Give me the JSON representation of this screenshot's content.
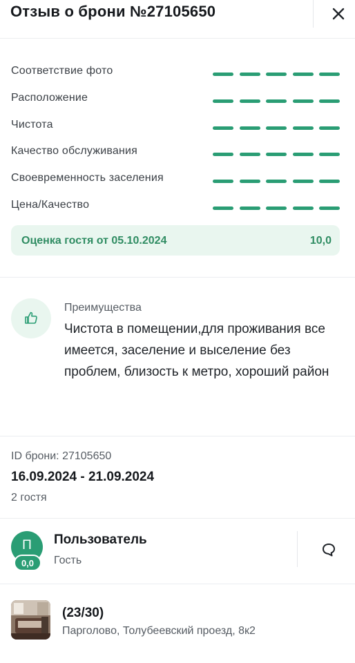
{
  "header": {
    "title": "Отзыв о брони №27105650",
    "close_icon": "close-icon"
  },
  "ratings": [
    {
      "label": "Соответствие фото",
      "filled": 5,
      "max": 5
    },
    {
      "label": "Расположение",
      "filled": 5,
      "max": 5
    },
    {
      "label": "Чистота",
      "filled": 5,
      "max": 5
    },
    {
      "label": "Качество обслуживания",
      "filled": 5,
      "max": 5
    },
    {
      "label": "Своевременность заселения",
      "filled": 5,
      "max": 5
    },
    {
      "label": "Цена/Качество",
      "filled": 5,
      "max": 5
    }
  ],
  "guest_score": {
    "label": "Оценка гостя от 05.10.2024",
    "value": "10,0"
  },
  "pros": {
    "icon": "thumbs-up-icon",
    "title": "Преимущества",
    "text": "Чистота в помещении,для проживания все имеется, заселение и выселение без проблем, близость к метро, хороший район"
  },
  "booking": {
    "id_label": "ID брони: 27105650",
    "dates": "16.09.2024 - 21.09.2024",
    "guests": "2 гостя"
  },
  "user": {
    "avatar_letter": "П",
    "rating_badge": "0,0",
    "name": "Пользователь",
    "role": "Гость",
    "chat_icon": "chat-icon"
  },
  "property": {
    "title": "(23/30)",
    "address": "Парголово, Толубеевский проезд, 8к2"
  },
  "colors": {
    "accent": "#2a9d74",
    "accent_light": "#e9f6ef",
    "score_text": "#2f8c62"
  }
}
